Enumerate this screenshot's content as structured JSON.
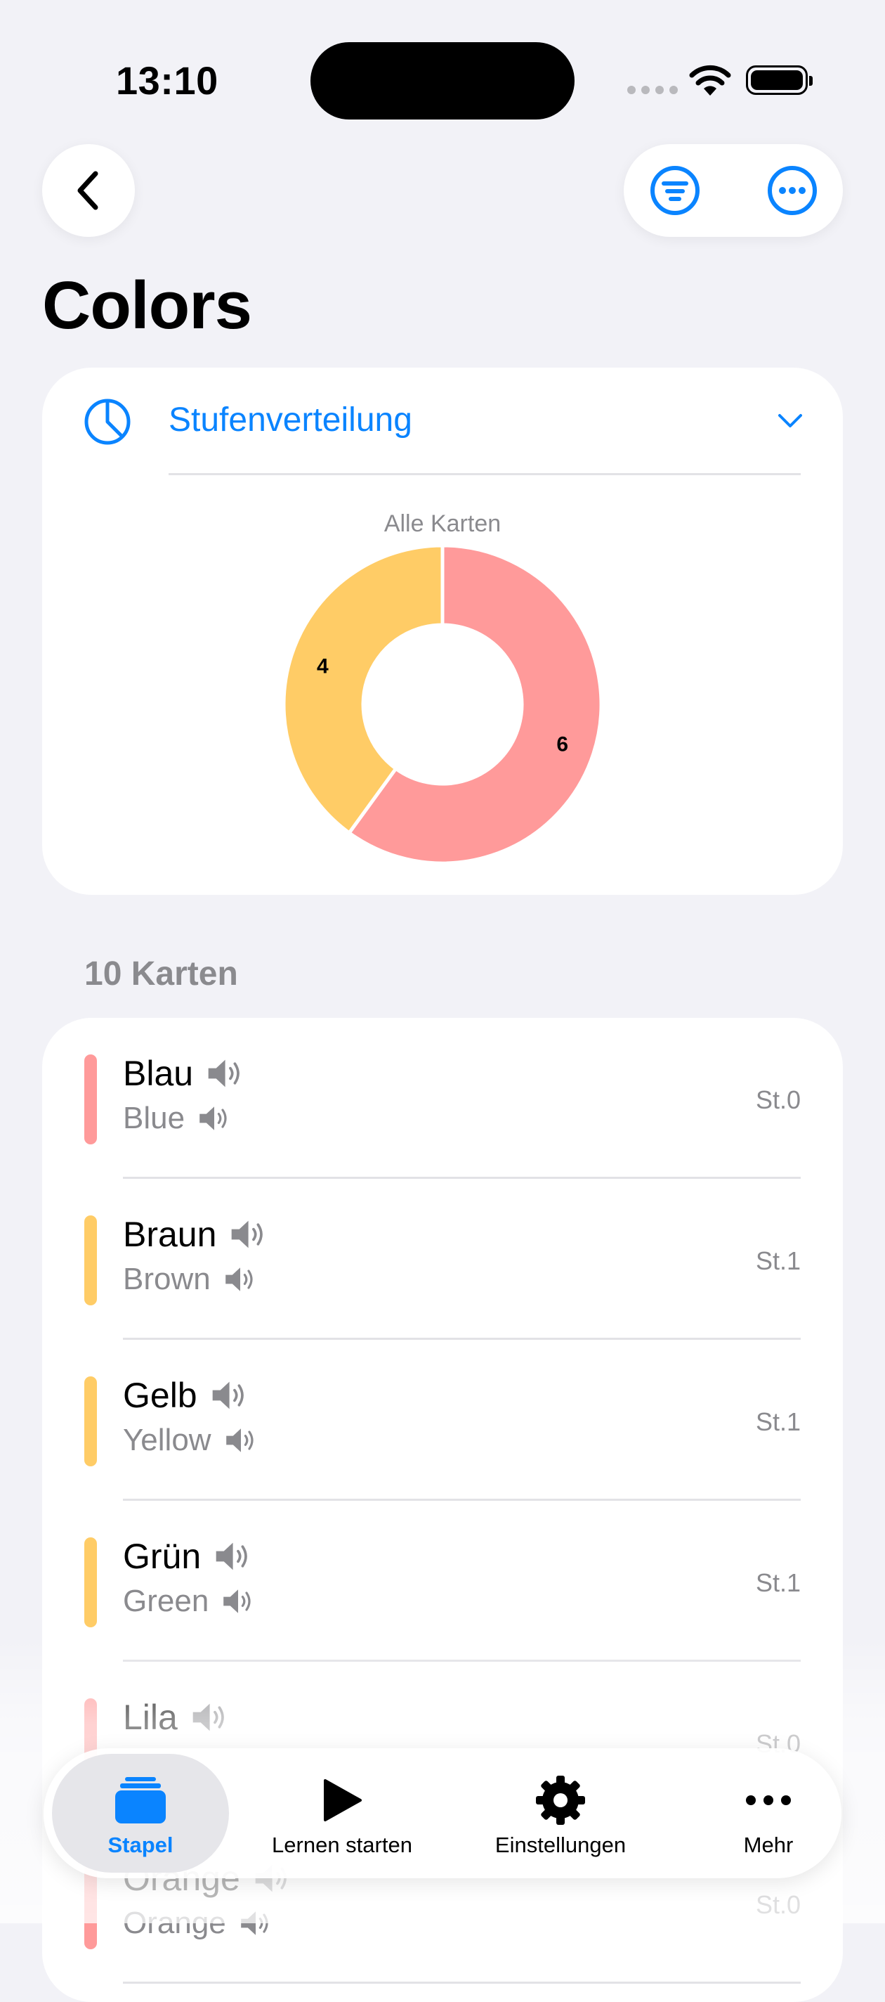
{
  "status_bar": {
    "time": "13:10"
  },
  "header": {
    "title": "Colors"
  },
  "icons": {
    "back": "chevron-left-icon",
    "filter": "filter-icon",
    "more": "ellipsis-circle-icon",
    "chart": "pie-chart-icon",
    "collapse": "chevron-down-icon",
    "speaker": "speaker-icon"
  },
  "colors": {
    "accent": "#0a84ff",
    "stage0": "#ff9a9a",
    "stage1": "#ffcc66"
  },
  "chart_section": {
    "title": "Stufenverteilung",
    "subtitle": "Alle Karten"
  },
  "chart_data": {
    "type": "pie",
    "title": "Alle Karten",
    "categories": [
      "St.0",
      "St.1"
    ],
    "values": [
      6,
      4
    ],
    "colors": [
      "#ff9a9a",
      "#ffcc66"
    ],
    "donut": true
  },
  "list": {
    "count_label": "10 Karten",
    "cards": [
      {
        "front": "Blau",
        "back": "Blue",
        "stage": "St.0",
        "color": "#ff9a9a"
      },
      {
        "front": "Braun",
        "back": "Brown",
        "stage": "St.1",
        "color": "#ffcc66"
      },
      {
        "front": "Gelb",
        "back": "Yellow",
        "stage": "St.1",
        "color": "#ffcc66"
      },
      {
        "front": "Grün",
        "back": "Green",
        "stage": "St.1",
        "color": "#ffcc66"
      },
      {
        "front": "Lila",
        "back": "",
        "stage": "St.0",
        "color": "#ff9a9a"
      },
      {
        "front": "Orange",
        "back": "Orange",
        "stage": "St.0",
        "color": "#ff9a9a"
      }
    ]
  },
  "tabbar": {
    "tabs": [
      {
        "label": "Stapel",
        "icon": "stack-icon",
        "active": true
      },
      {
        "label": "Lernen starten",
        "icon": "play-icon",
        "active": false
      },
      {
        "label": "Einstellungen",
        "icon": "gear-icon",
        "active": false
      },
      {
        "label": "Mehr",
        "icon": "ellipsis-icon",
        "active": false
      }
    ]
  }
}
